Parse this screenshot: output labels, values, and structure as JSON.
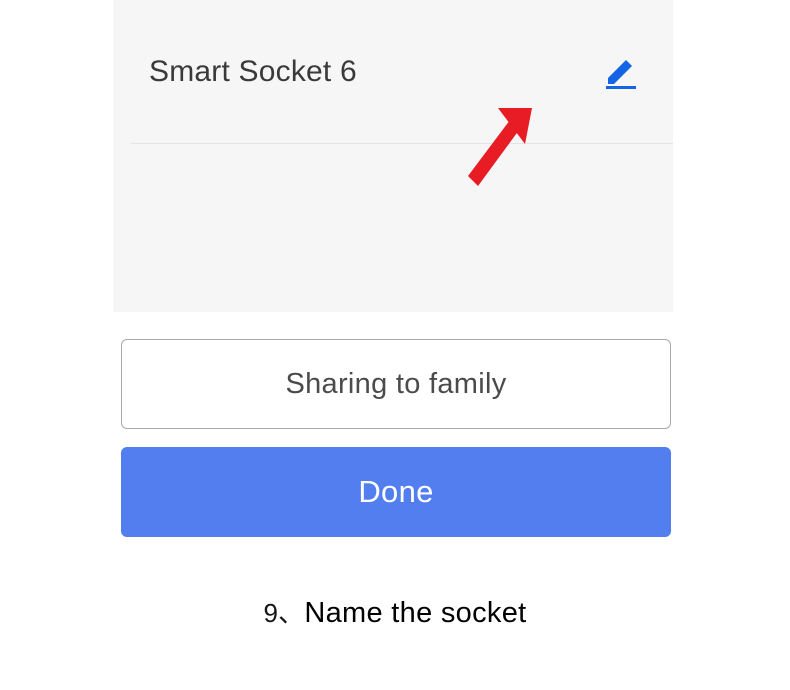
{
  "device": {
    "name": "Smart Socket 6"
  },
  "buttons": {
    "share_label": "Sharing to family",
    "done_label": "Done"
  },
  "caption": {
    "number": "9、",
    "text": "Name the socket"
  },
  "colors": {
    "primary": "#537ef0",
    "edit_icon": "#1464e6",
    "annotation": "#e81c24"
  }
}
